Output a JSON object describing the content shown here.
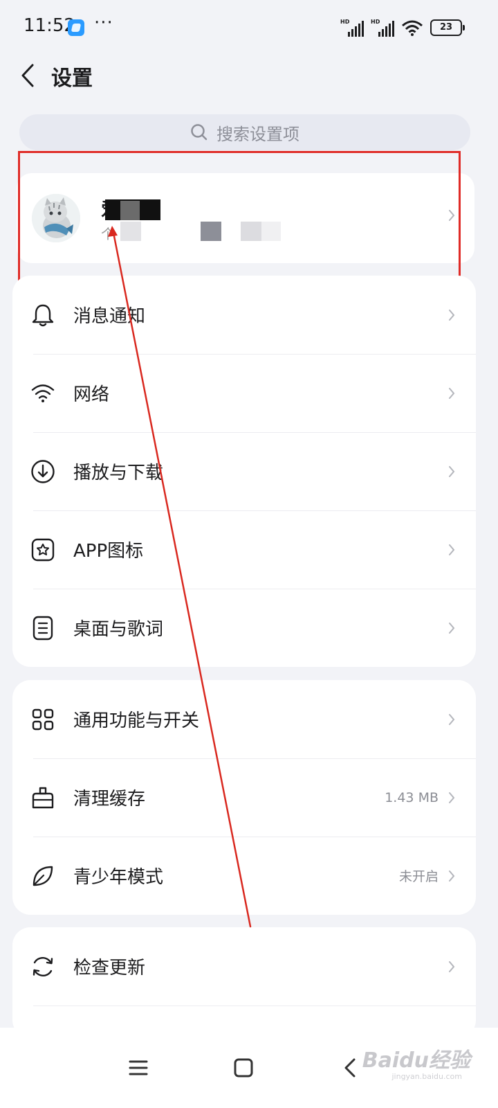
{
  "status_bar": {
    "time": "11:52",
    "dots": "···",
    "signal_1_label": "HD",
    "signal_2_label": "HD",
    "battery": "23"
  },
  "header": {
    "title": "设置"
  },
  "search": {
    "placeholder": "搜索设置项"
  },
  "profile": {
    "name_visible": "爱",
    "subtitle_visible": "个"
  },
  "groups": [
    {
      "items": [
        {
          "label": "消息通知",
          "icon": "bell-icon"
        },
        {
          "label": "网络",
          "icon": "wifi-icon"
        },
        {
          "label": "播放与下载",
          "icon": "download-icon"
        },
        {
          "label": "APP图标",
          "icon": "app-icon-icon"
        },
        {
          "label": "桌面与歌词",
          "icon": "lyrics-icon"
        }
      ]
    },
    {
      "items": [
        {
          "label": "通用功能与开关",
          "icon": "grid-icon"
        },
        {
          "label": "清理缓存",
          "icon": "broom-icon",
          "value": "1.43 MB"
        },
        {
          "label": "青少年模式",
          "icon": "leaf-icon",
          "value": "未开启"
        }
      ]
    },
    {
      "items": [
        {
          "label": "检查更新",
          "icon": "refresh-icon"
        }
      ]
    }
  ],
  "watermark": {
    "text": "Baidu经验",
    "sub": "jingyan.baidu.com"
  },
  "colors": {
    "highlight": "#e02b27",
    "background": "#f2f3f7",
    "card": "#ffffff"
  }
}
